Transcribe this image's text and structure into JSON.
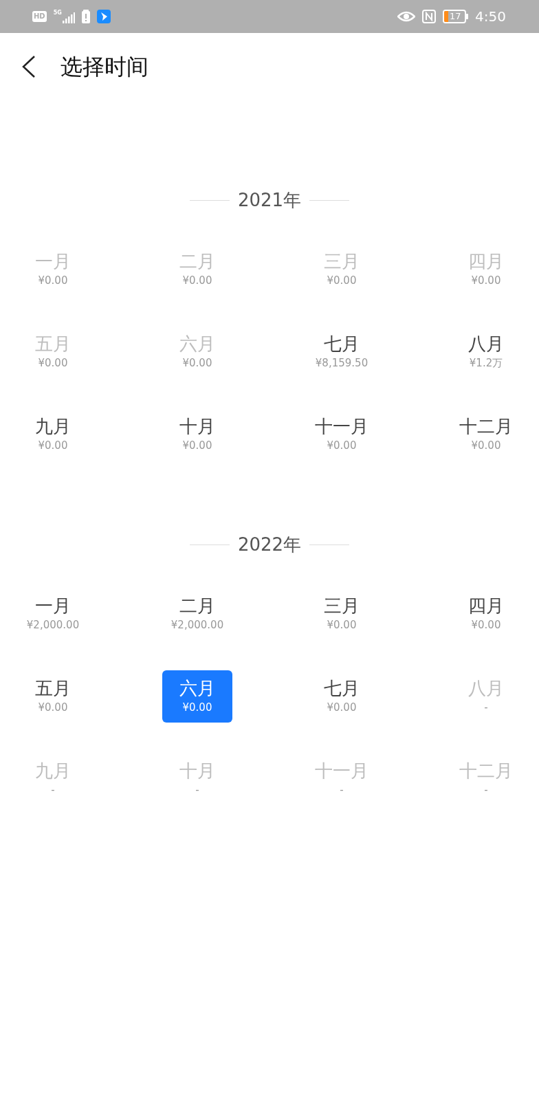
{
  "status_bar": {
    "hd_badge": "HD",
    "network": "5G",
    "battery_level": "17",
    "time": "4:50"
  },
  "header": {
    "title": "选择时间"
  },
  "years": [
    {
      "title": "2021年",
      "months": [
        {
          "label": "一月",
          "amount": "¥0.00",
          "disabled": true,
          "selected": false
        },
        {
          "label": "二月",
          "amount": "¥0.00",
          "disabled": true,
          "selected": false
        },
        {
          "label": "三月",
          "amount": "¥0.00",
          "disabled": true,
          "selected": false
        },
        {
          "label": "四月",
          "amount": "¥0.00",
          "disabled": true,
          "selected": false
        },
        {
          "label": "五月",
          "amount": "¥0.00",
          "disabled": true,
          "selected": false
        },
        {
          "label": "六月",
          "amount": "¥0.00",
          "disabled": true,
          "selected": false
        },
        {
          "label": "七月",
          "amount": "¥8,159.50",
          "disabled": false,
          "selected": false
        },
        {
          "label": "八月",
          "amount": "¥1.2万",
          "disabled": false,
          "selected": false
        },
        {
          "label": "九月",
          "amount": "¥0.00",
          "disabled": false,
          "selected": false
        },
        {
          "label": "十月",
          "amount": "¥0.00",
          "disabled": false,
          "selected": false
        },
        {
          "label": "十一月",
          "amount": "¥0.00",
          "disabled": false,
          "selected": false
        },
        {
          "label": "十二月",
          "amount": "¥0.00",
          "disabled": false,
          "selected": false
        }
      ]
    },
    {
      "title": "2022年",
      "months": [
        {
          "label": "一月",
          "amount": "¥2,000.00",
          "disabled": false,
          "selected": false
        },
        {
          "label": "二月",
          "amount": "¥2,000.00",
          "disabled": false,
          "selected": false
        },
        {
          "label": "三月",
          "amount": "¥0.00",
          "disabled": false,
          "selected": false
        },
        {
          "label": "四月",
          "amount": "¥0.00",
          "disabled": false,
          "selected": false
        },
        {
          "label": "五月",
          "amount": "¥0.00",
          "disabled": false,
          "selected": false
        },
        {
          "label": "六月",
          "amount": "¥0.00",
          "disabled": false,
          "selected": true
        },
        {
          "label": "七月",
          "amount": "¥0.00",
          "disabled": false,
          "selected": false
        },
        {
          "label": "八月",
          "amount": "-",
          "disabled": true,
          "selected": false
        },
        {
          "label": "九月",
          "amount": "-",
          "disabled": true,
          "selected": false
        },
        {
          "label": "十月",
          "amount": "-",
          "disabled": true,
          "selected": false
        },
        {
          "label": "十一月",
          "amount": "-",
          "disabled": true,
          "selected": false
        },
        {
          "label": "十二月",
          "amount": "-",
          "disabled": true,
          "selected": false
        }
      ]
    }
  ]
}
